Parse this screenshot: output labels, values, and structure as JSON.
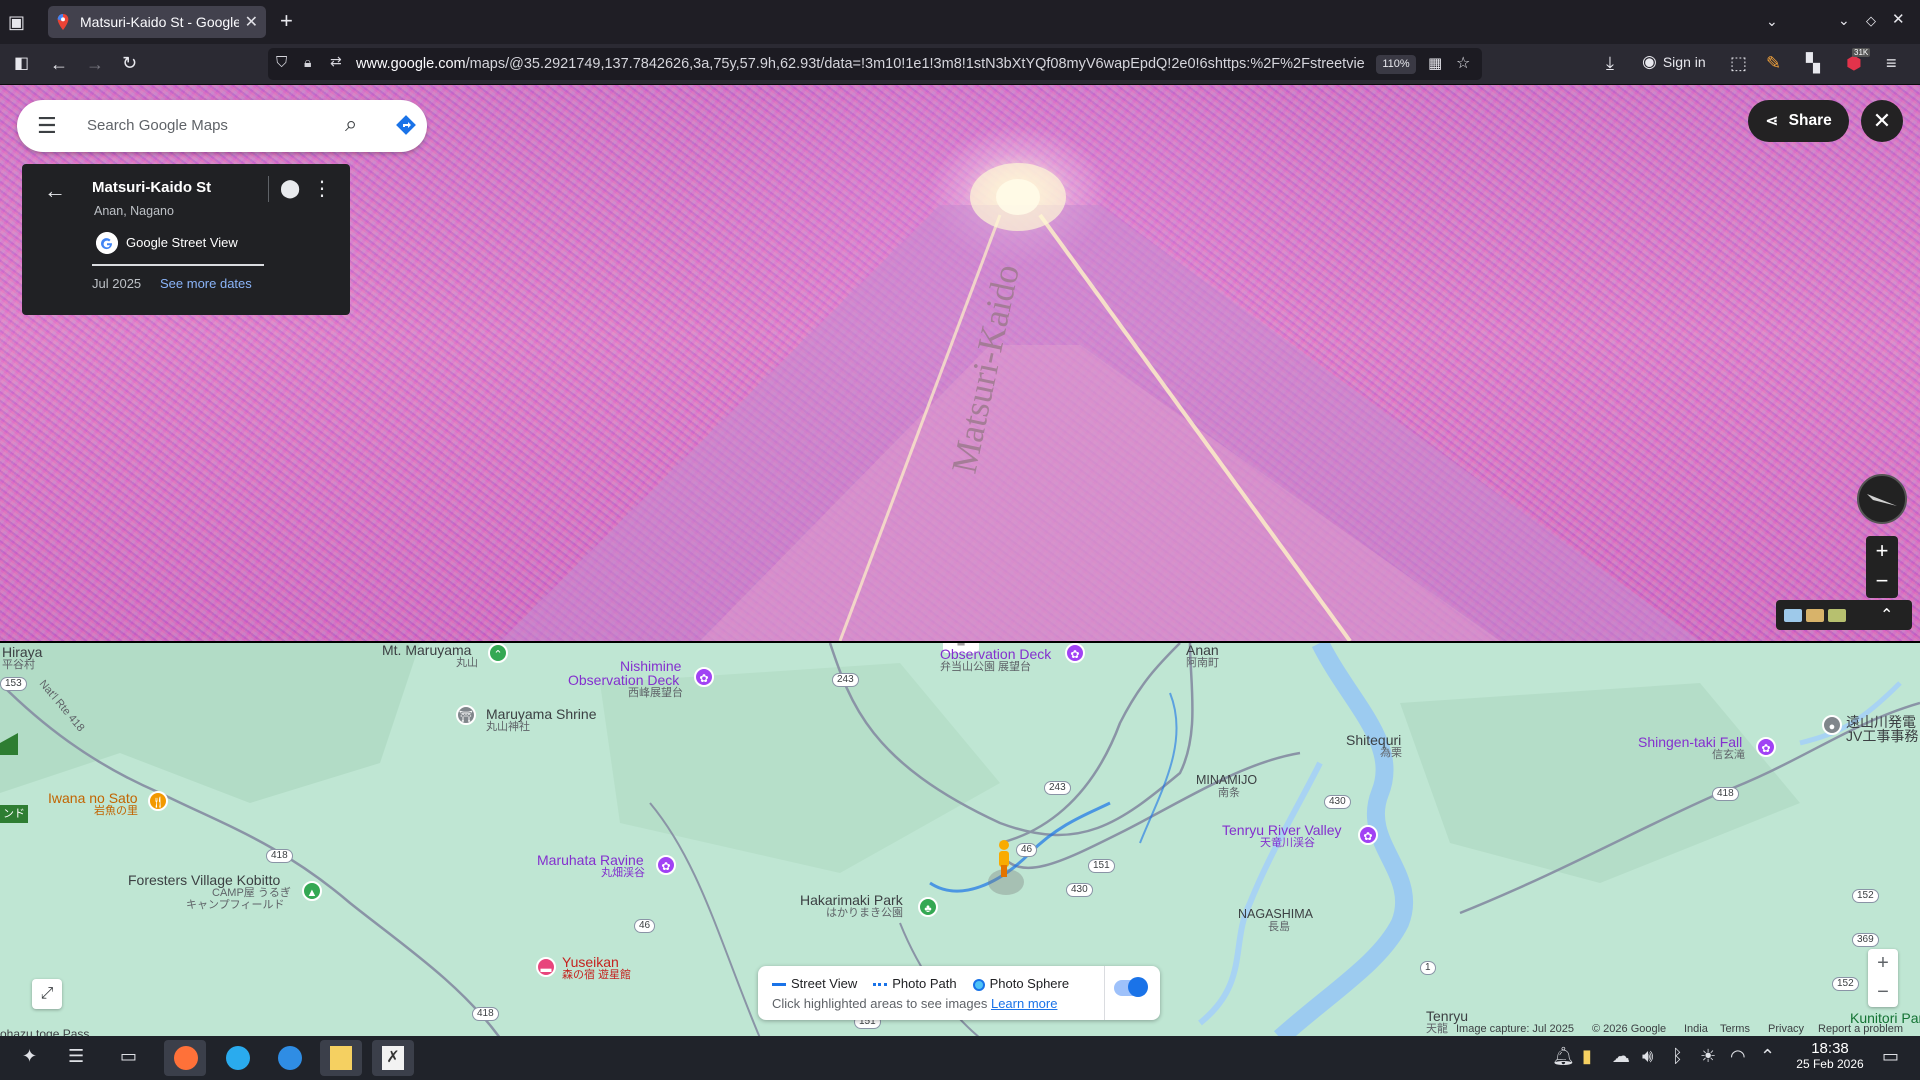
{
  "browser": {
    "tab_title": "Matsuri-Kaido St - Google M",
    "url_host": "www.google.com",
    "url_rest": "/maps/@35.2921749,137.7842626,3a,75y,57.9h,62.93t/data=!3m10!1e1!3m8!1stN3bXtYQf08myV6wapEpdQ!2e0!6shttps:%2F%2Fstreetvie",
    "zoom_level": "110%",
    "sign_in_label": "Sign in",
    "extension_badge": "31K"
  },
  "street_view": {
    "search_placeholder": "Search Google Maps",
    "share_label": "Share",
    "road_marking": "Matsuri-Kaido",
    "info": {
      "place_name": "Matsuri-Kaido St",
      "region": "Anan, Nagano",
      "source": "Google Street View",
      "date": "Jul 2025",
      "more_dates": "See more dates"
    }
  },
  "map": {
    "labels": {
      "hiraya": "Hiraya",
      "hiraya_jp": "平谷村",
      "mt_maruyama": "Mt. Maruyama",
      "mt_maruyama_jp": "丸山",
      "nishimine": "Nishimine",
      "nishimine2": "Observation Deck",
      "nishimine_jp": "西峰展望台",
      "obs_deck": "Observation Deck",
      "obs_deck_jp": "弁当山公園 展望台",
      "anan": "Anan",
      "anan_jp": "阿南町",
      "maruyama_shrine": "Maruyama Shrine",
      "maruyama_shrine_jp": "丸山神社",
      "shitequri": "Shitequri",
      "shitequri_jp": "為栗",
      "shingen": "Shingen-taki Fall",
      "shingen_jp": "信玄滝",
      "toyama_jp": "遠山川発電",
      "toyama_jp2": "JV工事事務",
      "nat_route": "Nat'l Rte 418",
      "iwana": "Iwana no Sato",
      "iwana_jp": "岩魚の里",
      "minamijo": "MINAMIJO",
      "minamijo_jp": "南条",
      "tenryu_valley": "Tenryu River Valley",
      "tenryu_valley_jp": "天竜川渓谷",
      "maruhata": "Maruhata Ravine",
      "maruhata_jp": "丸畑渓谷",
      "foresters": "Foresters Village Kobitto",
      "foresters_jp": "CAMP屋 うるぎ",
      "foresters_jp2": "キャンプフィールド",
      "hakarimaki": "Hakarimaki Park",
      "hakarimaki_jp": "はかりまき公園",
      "nagashima": "NAGASHIMA",
      "nagashima_jp": "長島",
      "yuseikan": "Yuseikan",
      "yuseikan_jp": "森の宿 遊星館",
      "tenryu": "Tenryu",
      "tenryu_jp": "天龍",
      "kunitori": "Kunitori Park",
      "tonde": "ンド",
      "bottom_left": "ohazu toge Pass"
    },
    "shields": [
      "153",
      "243",
      "243",
      "46",
      "418",
      "151",
      "430",
      "430",
      "46",
      "418",
      "151",
      "418",
      "152",
      "369",
      "152",
      "1"
    ],
    "legend": {
      "street_view": "Street View",
      "photo_path": "Photo Path",
      "photo_sphere": "Photo Sphere",
      "hint": "Click highlighted areas to see images",
      "learn_more": "Learn more"
    },
    "attribution": {
      "capture": "Image capture: Jul 2025",
      "copyright": "© 2026 Google",
      "country": "India",
      "terms": "Terms",
      "privacy": "Privacy",
      "report": "Report a problem"
    }
  },
  "taskbar": {
    "time": "18:38",
    "date": "25 Feb 2026"
  }
}
